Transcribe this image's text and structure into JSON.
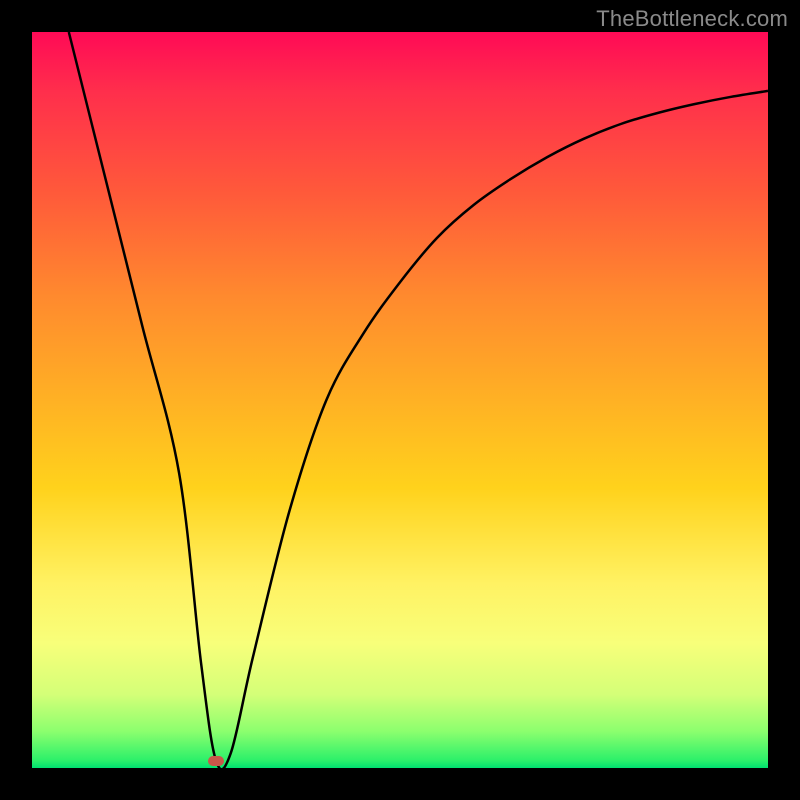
{
  "watermark": "TheBottleneck.com",
  "colors": {
    "frame": "#000000",
    "curve": "#000000",
    "marker": "#c9564a"
  },
  "chart_data": {
    "type": "line",
    "title": "",
    "xlabel": "",
    "ylabel": "",
    "xlim": [
      0,
      100
    ],
    "ylim": [
      0,
      100
    ],
    "grid": false,
    "legend": false,
    "series": [
      {
        "name": "curve",
        "x": [
          5,
          10,
          15,
          20,
          23,
          25,
          27,
          30,
          35,
          40,
          45,
          50,
          55,
          60,
          65,
          70,
          75,
          80,
          85,
          90,
          95,
          100
        ],
        "values": [
          100,
          80,
          60,
          40,
          14,
          1,
          2,
          15,
          35,
          50,
          59,
          66,
          72,
          76.5,
          80,
          83,
          85.5,
          87.5,
          89,
          90.2,
          91.2,
          92
        ]
      }
    ],
    "marker": {
      "x": 25,
      "y": 1
    },
    "background_gradient": {
      "top": "#ff0a56",
      "mid": "#ffd21c",
      "bottom": "#00e070"
    }
  }
}
